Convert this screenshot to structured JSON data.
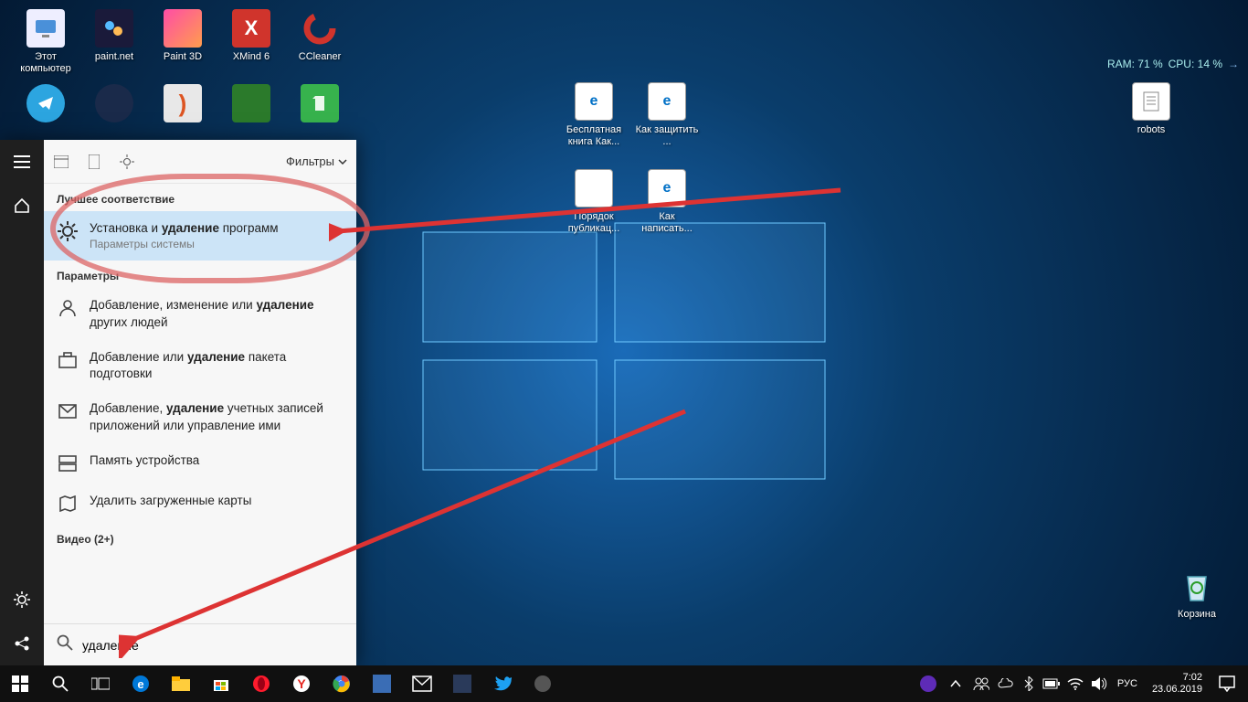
{
  "desktop": {
    "icons_row1": [
      {
        "label": "Этот\nкомпьютер",
        "bg": "#fff"
      },
      {
        "label": "paint.net",
        "bg": "#223"
      },
      {
        "label": "Paint 3D",
        "bg": "#ff5ea0"
      },
      {
        "label": "XMind 6",
        "bg": "#d0342c"
      },
      {
        "label": "CCleaner",
        "bg": "#c51d23"
      }
    ],
    "icons_row2": [
      {
        "label": "",
        "bg": "#2ca5e0"
      },
      {
        "label": "",
        "bg": "#1a1a2e"
      },
      {
        "label": "",
        "bg": "#e03030"
      },
      {
        "label": "",
        "bg": "#2b8f2b"
      },
      {
        "label": "",
        "bg": "#37b24d"
      }
    ],
    "center_icons": [
      {
        "label": "Бесплатная книга Как...",
        "type": "epdf"
      },
      {
        "label": "Как защитить ...",
        "type": "epdf"
      },
      {
        "label": "Порядок публикац...",
        "type": "doc"
      },
      {
        "label": "Как написать...",
        "type": "edge"
      }
    ],
    "robots_label": "robots",
    "recycle_label": "Корзина"
  },
  "widget": {
    "ram": "RAM: 71 %",
    "cpu": "CPU: 14 %"
  },
  "search": {
    "filters_label": "Фильтры",
    "best_match_label": "Лучшее соответствие",
    "params_label": "Параметры",
    "video_label": "Видео (2+)",
    "query": "удаление",
    "best": {
      "pre": "Установка и ",
      "bold": "удаление",
      "post": " программ",
      "sub": "Параметры системы"
    },
    "results": [
      {
        "icon": "account",
        "pre": "Добавление, изменение или ",
        "bold": "удаление",
        "post": " других людей"
      },
      {
        "icon": "briefcase",
        "pre": "Добавление или ",
        "bold": "удаление",
        "post": " пакета подготовки"
      },
      {
        "icon": "mail",
        "pre": "Добавление, ",
        "bold": "удаление",
        "post": " учетных записей приложений или управление ими"
      },
      {
        "icon": "storage",
        "pre": "",
        "bold": "",
        "post": "Память устройства"
      },
      {
        "icon": "map",
        "pre": "",
        "bold": "",
        "post": "Удалить загруженные карты"
      }
    ]
  },
  "taskbar": {
    "lang": "РУС",
    "time": "7:02",
    "date": "23.06.2019"
  }
}
